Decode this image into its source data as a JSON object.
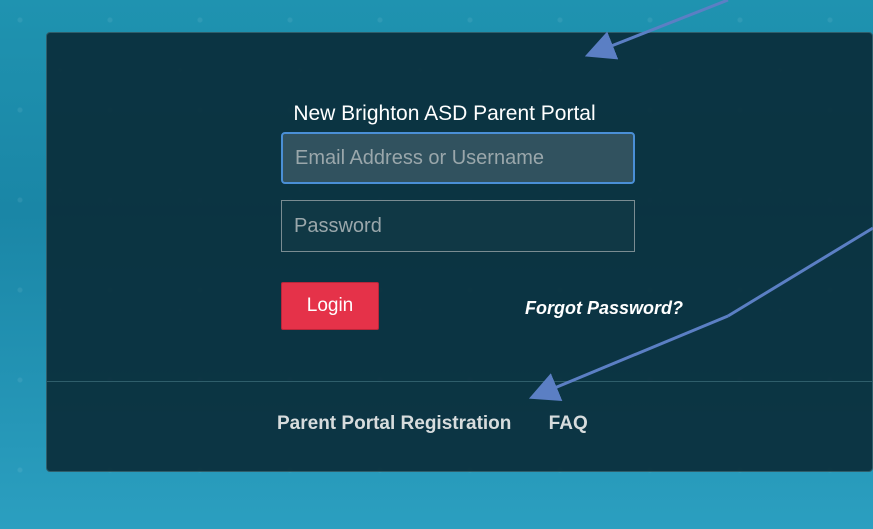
{
  "portal": {
    "title": "New Brighton ASD Parent Portal"
  },
  "login_form": {
    "email_placeholder": "Email Address or Username",
    "password_placeholder": "Password",
    "login_label": "Login",
    "forgot_password_label": "Forgot Password?"
  },
  "footer": {
    "registration_label": "Parent Portal Registration",
    "faq_label": "FAQ"
  },
  "colors": {
    "background": "#1f93b0",
    "panel": "#0a2d3a",
    "login_button": "#e53249",
    "annotation_arrow": "#5b7fc4"
  }
}
